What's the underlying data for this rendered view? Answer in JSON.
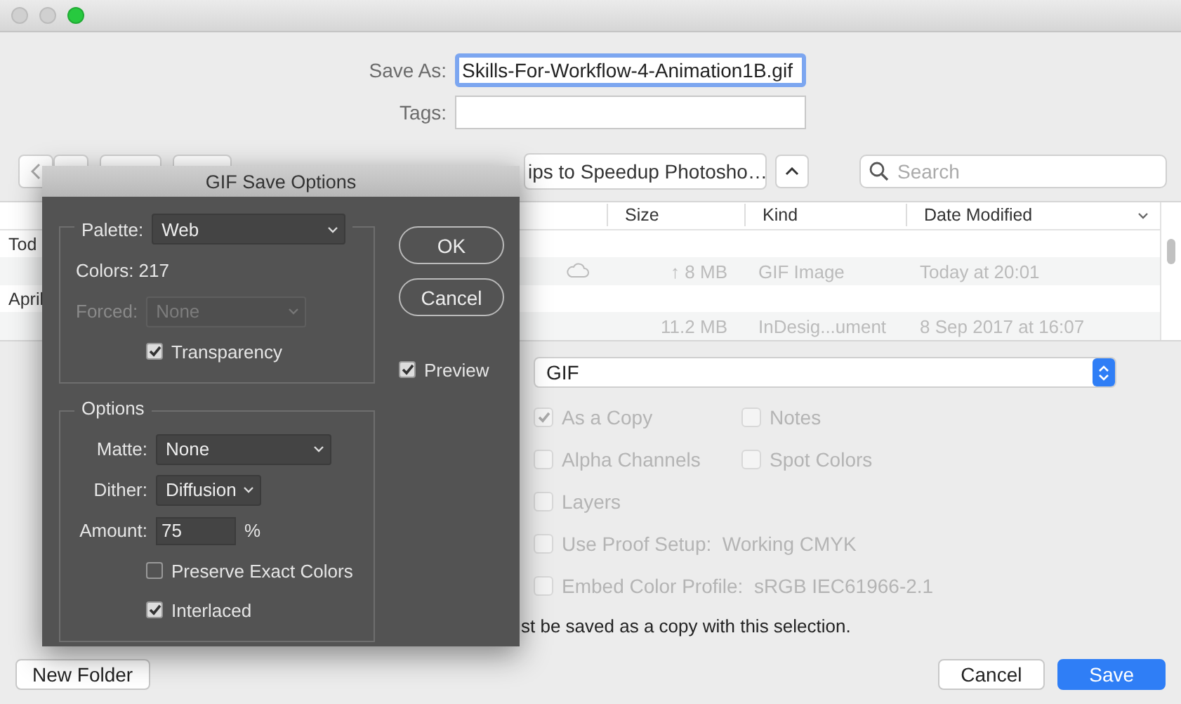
{
  "window": {
    "controls": [
      {
        "kind": "close",
        "active": false
      },
      {
        "kind": "minimize",
        "active": false
      },
      {
        "kind": "zoom",
        "active": true
      }
    ]
  },
  "save_as": {
    "label": "Save As:",
    "value": "Skills-For-Workflow-4-Animation1B.gif"
  },
  "tags": {
    "label": "Tags:"
  },
  "toolbar": {
    "location": "ips to Speedup Photosho…",
    "search": {
      "placeholder": "Search"
    }
  },
  "file_list": {
    "columns": [
      {
        "label": "Size"
      },
      {
        "label": "Kind"
      },
      {
        "label": "Date Modified"
      }
    ],
    "rows": [
      {
        "kind": "group",
        "label": "Tod"
      },
      {
        "kind": "file",
        "cloud": true,
        "size": "↑ 8 MB",
        "file_type": "GIF Image",
        "date": "Today at 20:01"
      },
      {
        "kind": "group",
        "label": "April"
      },
      {
        "kind": "file",
        "cloud": false,
        "size": "11.2 MB",
        "file_type": "InDesig...ument",
        "date": "8 Sep 2017 at 16:07"
      }
    ]
  },
  "format": "GIF",
  "options": [
    {
      "items": [
        {
          "label": "As a Copy",
          "checked": true,
          "disabled": true
        },
        {
          "label": "Notes",
          "checked": false,
          "disabled": true
        }
      ]
    },
    {
      "items": [
        {
          "label": "Alpha Channels",
          "checked": false,
          "disabled": true
        },
        {
          "label": "Spot Colors",
          "checked": false,
          "disabled": true
        }
      ]
    },
    {
      "items": [
        {
          "label": "Layers",
          "checked": false,
          "disabled": true
        }
      ]
    },
    {
      "items": [
        {
          "label": "Use Proof Setup:  Working CMYK",
          "checked": false,
          "disabled": true
        }
      ]
    },
    {
      "items": [
        {
          "label": "Embed Color Profile:  sRGB IEC61966-2.1",
          "checked": false,
          "disabled": true
        }
      ]
    }
  ],
  "warning": "st be saved as a copy with this selection.",
  "buttons": {
    "new_folder": "New Folder",
    "cancel": "Cancel",
    "save": "Save"
  },
  "dialog": {
    "title": "GIF Save Options",
    "palette": {
      "label": "Palette:",
      "value": "Web"
    },
    "colors": "Colors: 217",
    "forced": {
      "label": "Forced:",
      "value": "None",
      "disabled": true
    },
    "transparency": {
      "label": "Transparency",
      "checked": true
    },
    "options_group": {
      "title": "Options",
      "matte": {
        "label": "Matte:",
        "value": "None"
      },
      "dither": {
        "label": "Dither:",
        "value": "Diffusion"
      },
      "amount": {
        "label": "Amount:",
        "value": "75",
        "unit": "%"
      },
      "checks": [
        {
          "label": "Preserve Exact Colors",
          "checked": false
        },
        {
          "label": "Interlaced",
          "checked": true
        }
      ]
    },
    "ok": "OK",
    "cancel": "Cancel",
    "preview": {
      "label": "Preview",
      "checked": true
    }
  }
}
